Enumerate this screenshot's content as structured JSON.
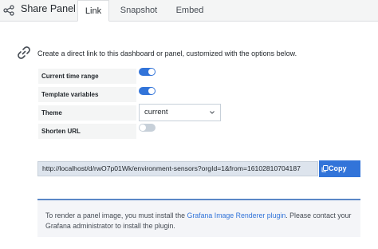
{
  "header": {
    "title": "Share Panel",
    "tabs": [
      {
        "label": "Link",
        "active": true
      },
      {
        "label": "Snapshot",
        "active": false
      },
      {
        "label": "Embed",
        "active": false
      }
    ]
  },
  "main": {
    "description": "Create a direct link to this dashboard or panel, customized with the options below.",
    "options": {
      "current_time_range": {
        "label": "Current time range",
        "enabled": true
      },
      "template_variables": {
        "label": "Template variables",
        "enabled": true
      },
      "theme": {
        "label": "Theme",
        "value": "current"
      },
      "shorten_url": {
        "label": "Shorten URL",
        "enabled": false
      }
    },
    "link_url": "http://localhost/d/rwO7p01Wk/environment-sensors?orgId=1&from=16102810704187",
    "copy_label": "Copy",
    "info": {
      "before": "To render a panel image, you must install the ",
      "link": "Grafana Image Renderer plugin",
      "after": ". Please contact your Grafana administrator to install the plugin."
    }
  },
  "colors": {
    "accent": "#3274d9",
    "toggle_off": "#c7d0d9"
  },
  "icons": [
    "share-icon",
    "link-icon",
    "chevron-down-icon",
    "copy-icon"
  ]
}
